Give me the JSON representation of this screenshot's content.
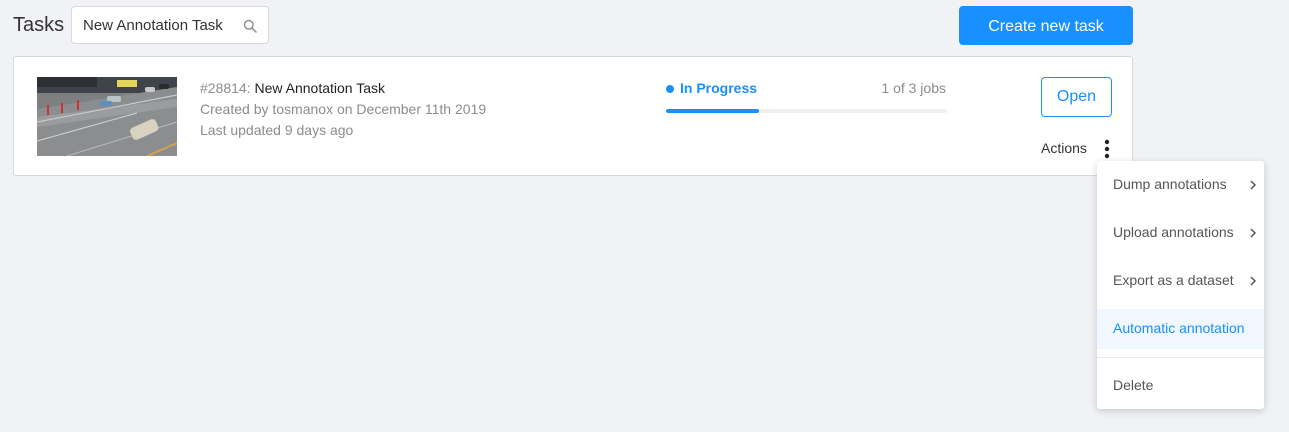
{
  "header": {
    "title": "Tasks",
    "search_value": "New Annotation Task",
    "search_icon": "search-icon",
    "create_label": "Create new task"
  },
  "task": {
    "id": "#28814:",
    "name": "New Annotation Task",
    "created": "Created by tosmanox on December 11th 2019",
    "updated": "Last updated 9 days ago",
    "status": "In Progress",
    "jobs": "1 of 3 jobs",
    "progress": 0.33,
    "open_label": "Open",
    "actions_label": "Actions"
  },
  "actions_menu": {
    "items": [
      {
        "label": "Dump annotations",
        "submenu": true
      },
      {
        "label": "Upload annotations",
        "submenu": true
      },
      {
        "label": "Export as a dataset",
        "submenu": true
      },
      {
        "label": "Automatic annotation",
        "submenu": false
      },
      {
        "label": "Delete",
        "submenu": false
      }
    ],
    "highlighted": "Automatic annotation"
  },
  "colors": {
    "accent": "#1890ff",
    "background": "#f0f2f5",
    "muted_text": "#8c8c8c"
  }
}
